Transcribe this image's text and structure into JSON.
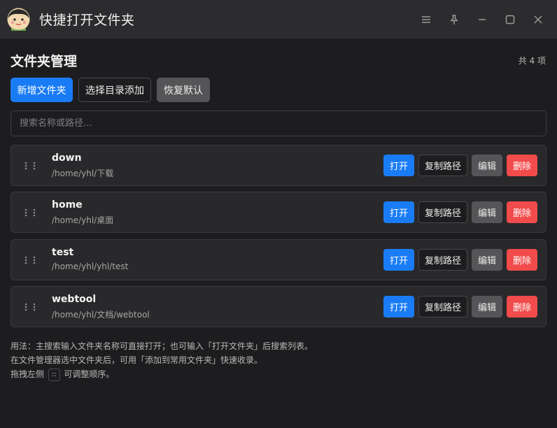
{
  "app": {
    "title": "快捷打开文件夹"
  },
  "window_controls": [
    "menu-icon",
    "pin-icon",
    "minimize-icon",
    "maximize-icon",
    "close-icon"
  ],
  "page": {
    "title": "文件夹管理",
    "count": "共 4 项"
  },
  "toolbar": {
    "add_label": "新增文件夹",
    "select_dir_label": "选择目录添加",
    "reset_label": "恢复默认"
  },
  "search": {
    "placeholder": "搜索名称或路径…",
    "value": ""
  },
  "row_actions": {
    "open": "打开",
    "copy_path": "复制路径",
    "edit": "编辑",
    "delete": "删除"
  },
  "folders": [
    {
      "name": "down",
      "path": "/home/yhl/下载"
    },
    {
      "name": "home",
      "path": "/home/yhl/桌面"
    },
    {
      "name": "test",
      "path": "/home/yhl/yhl/test"
    },
    {
      "name": "webtool",
      "path": "/home/yhl/文档/webtool"
    }
  ],
  "footer": {
    "line1": "用法：主搜索输入文件夹名称可直接打开；也可输入「打开文件夹」后搜索列表。",
    "line2": "在文件管理器选中文件夹后，可用「添加到常用文件夹」快速收录。",
    "line3_prefix": "拖拽左侧",
    "line3_key": "::",
    "line3_suffix": "可调整顺序。"
  },
  "colors": {
    "primary": "#1a7cf5",
    "danger": "#f24b4b",
    "neutral": "#555557",
    "background": "#1d1d1f",
    "card": "#29292b"
  }
}
